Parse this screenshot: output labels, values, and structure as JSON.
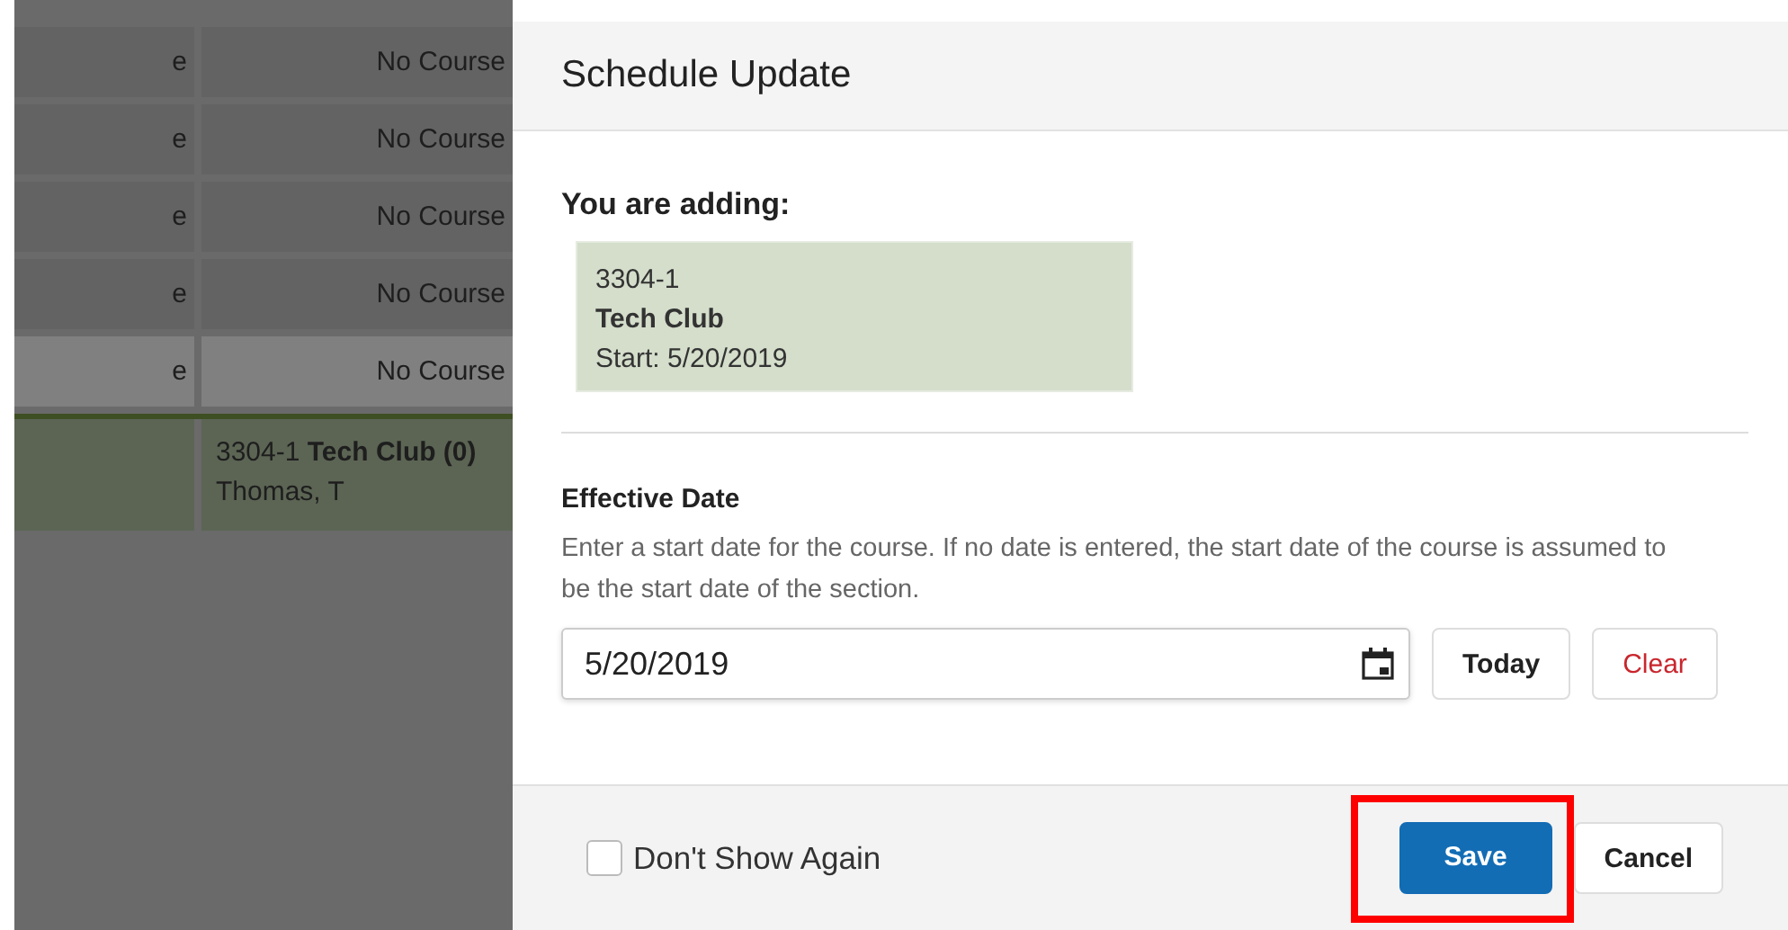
{
  "background_table": {
    "rows": [
      {
        "kind": "plain",
        "highlighted": false,
        "cells": [
          "e",
          "No Course"
        ]
      },
      {
        "kind": "plain",
        "highlighted": false,
        "cells": [
          "e",
          "No Course"
        ]
      },
      {
        "kind": "plain",
        "highlighted": false,
        "cells": [
          "e",
          "No Course"
        ]
      },
      {
        "kind": "plain",
        "highlighted": false,
        "cells": [
          "e",
          "No Course"
        ]
      },
      {
        "kind": "plain",
        "highlighted": true,
        "cells": [
          "e",
          "No Course"
        ]
      },
      {
        "kind": "course",
        "cells": [
          "",
          "3304-1 **Tech Club (0)**"
        ],
        "teacher": "Thomas, T"
      }
    ]
  },
  "dialog": {
    "title": "Schedule Update",
    "adding_label": "You are adding:",
    "adding": {
      "code": "3304-1",
      "name": "Tech Club",
      "start": "Start: 5/20/2019"
    },
    "effective_date": {
      "label": "Effective Date",
      "help": "Enter a start date for the course. If no date is entered, the start date of the course is assumed to be the start date of the section.",
      "value": "5/20/2019",
      "buttons": [
        {
          "kind": "default",
          "label": "Today"
        },
        {
          "kind": "danger",
          "label": "Clear"
        }
      ]
    },
    "footer": {
      "checkbox": {
        "label": "Don't Show Again",
        "checked": false
      },
      "buttons": [
        {
          "kind": "primary",
          "label": "Save",
          "highlighted": true
        },
        {
          "kind": "default",
          "label": "Cancel",
          "highlighted": false
        }
      ]
    }
  }
}
